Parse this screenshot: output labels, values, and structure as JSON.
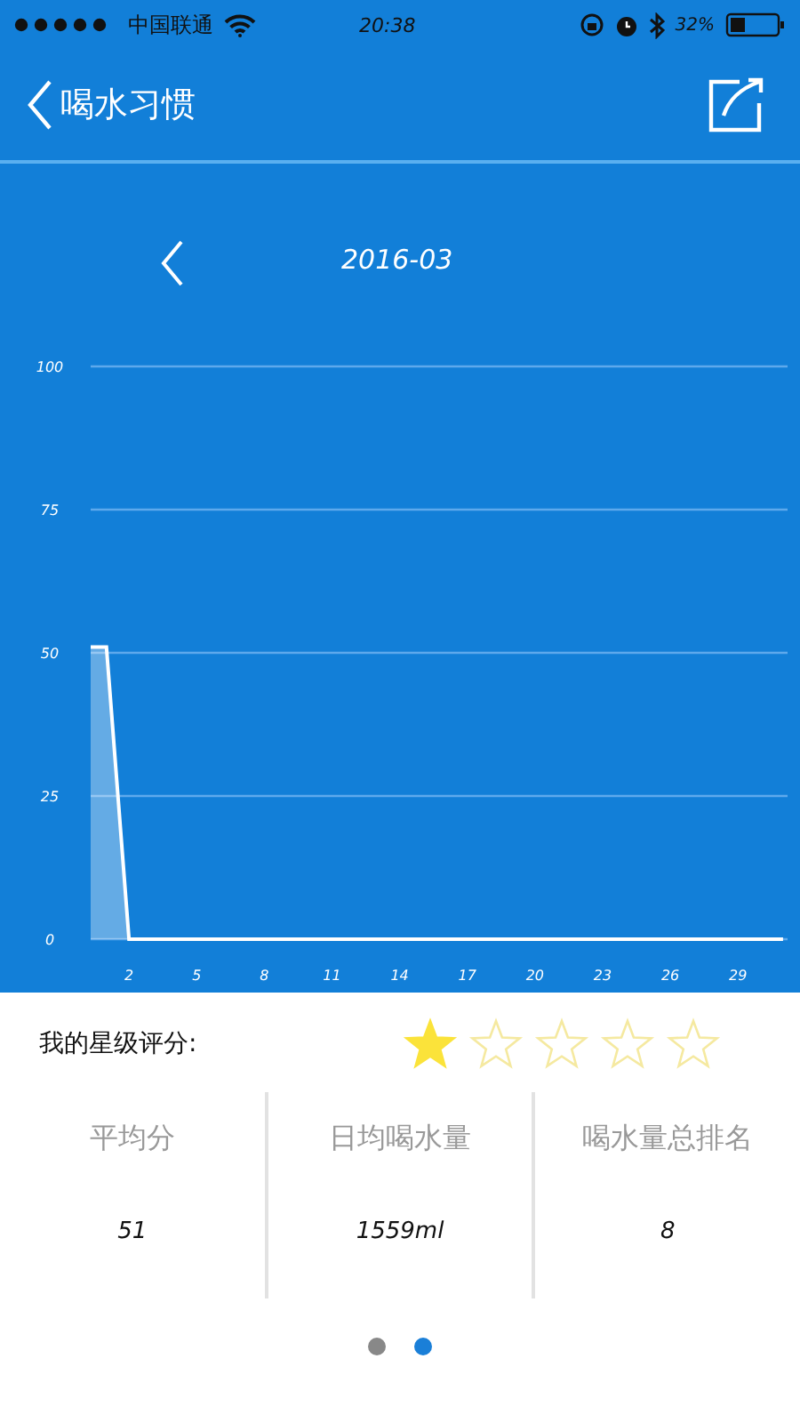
{
  "status_bar": {
    "carrier": "中国联通",
    "time": "20:38",
    "battery_text": "32%"
  },
  "nav": {
    "title": "喝水习惯"
  },
  "month": "2016-03",
  "chart": {
    "chart_data": {
      "type": "area",
      "x": [
        0.3,
        1,
        2,
        3,
        4,
        5,
        6,
        7,
        8,
        9,
        10,
        11,
        12,
        13,
        14,
        15,
        16,
        17,
        18,
        19,
        20,
        21,
        22,
        23,
        24,
        25,
        26,
        27,
        28,
        29,
        30,
        31
      ],
      "series": [
        {
          "color": "#ffffff",
          "values": [
            51,
            51,
            0,
            0,
            0,
            0,
            0,
            0,
            0,
            0,
            0,
            0,
            0,
            0,
            0,
            0,
            0,
            0,
            0,
            0,
            0,
            0,
            0,
            0,
            0,
            0,
            0,
            0,
            0,
            0,
            0,
            0
          ]
        }
      ],
      "xlim": [
        0.3,
        31.2
      ],
      "ylim": [
        0,
        100
      ],
      "xticks": [
        2,
        5,
        8,
        11,
        14,
        17,
        20,
        23,
        26,
        29
      ],
      "yticks": [
        0,
        25,
        50,
        75,
        100
      ],
      "grid": true
    }
  },
  "rating": {
    "label": "我的星级评分:",
    "stars": 1
  },
  "stats": [
    {
      "label": "平均分",
      "value": "51"
    },
    {
      "label": "日均喝水量",
      "value": "1559ml"
    },
    {
      "label": "喝水量总排名",
      "value": "8"
    }
  ],
  "pager": [
    {
      "selected": false
    },
    {
      "selected": true
    }
  ]
}
